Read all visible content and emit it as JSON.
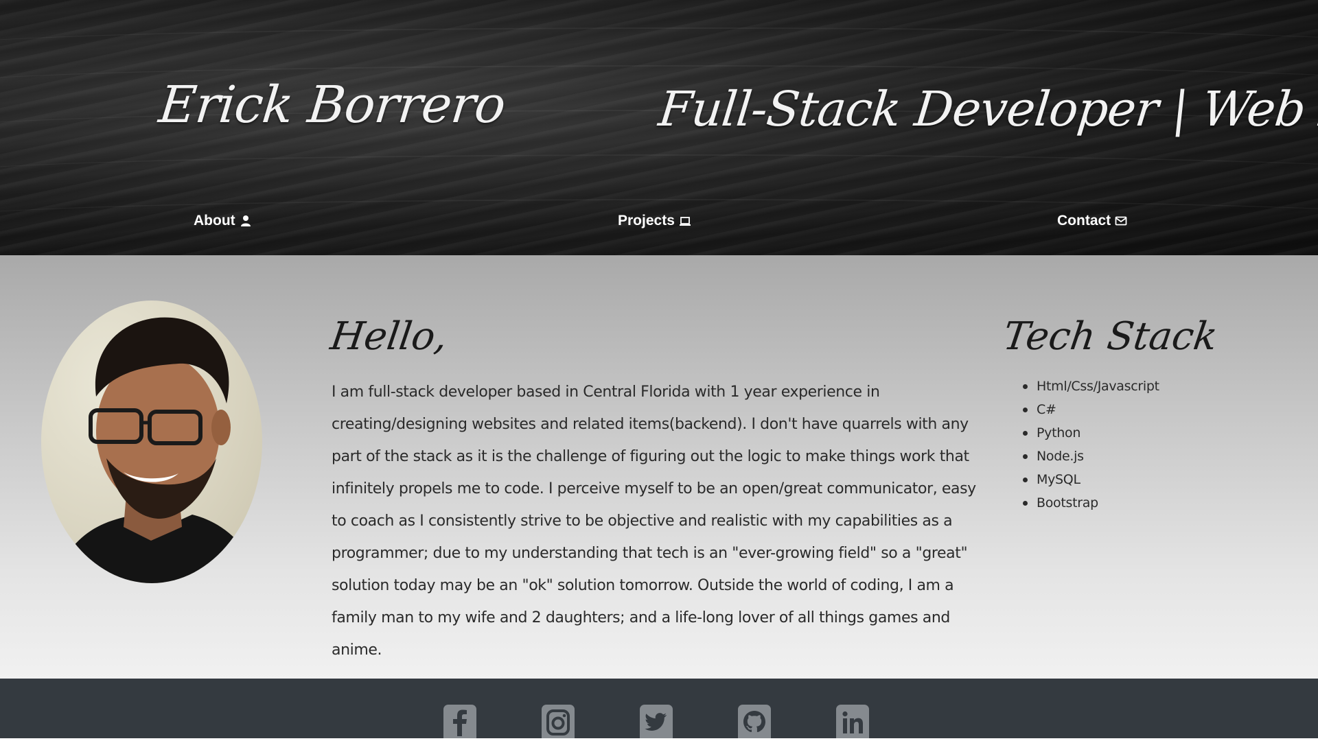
{
  "header": {
    "name": "Erick Borrero",
    "tagline": "Full-Stack Developer | Web Designer"
  },
  "nav": [
    {
      "label": "About",
      "icon": "user-icon"
    },
    {
      "label": "Projects",
      "icon": "laptop-icon"
    },
    {
      "label": "Contact",
      "icon": "envelope-icon"
    }
  ],
  "main": {
    "greeting": "Hello,",
    "bio": "I am full-stack developer based in Central Florida with 1 year experience in creating/designing websites and related items(backend). I don't have quarrels with any part of the stack as it is the challenge of figuring out the logic to make things work that infinitely propels me to code. I perceive myself to be an open/great communicator, easy to coach as I consistently strive to be objective and realistic with my capabilities as a programmer; due to my understanding that tech is an \"ever-growing field\" so a \"great\" solution today may be an \"ok\" solution tomorrow. Outside the world of coding, I am a family man to my wife and 2 daughters; and a life-long lover of all things games and anime.",
    "tech_stack_title": "Tech Stack",
    "tech_stack": [
      "Html/Css/Javascript",
      "C#",
      "Python",
      "Node.js",
      "MySQL",
      "Bootstrap"
    ]
  },
  "footer": {
    "social": [
      "facebook-icon",
      "instagram-icon",
      "twitter-icon",
      "github-icon",
      "linkedin-icon"
    ]
  },
  "colors": {
    "header_bg": "#1c1c1c",
    "footer_bg": "#343a40",
    "social_icon": "#858a8f",
    "text_dark": "#2a2a2a"
  }
}
